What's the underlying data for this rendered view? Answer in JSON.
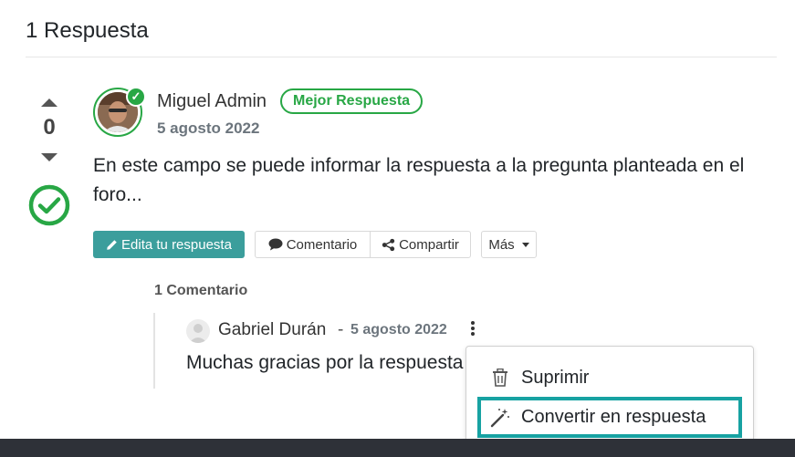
{
  "section": {
    "title": "1 Respuesta"
  },
  "vote": {
    "count": "0"
  },
  "answer": {
    "author": "Miguel Admin",
    "badge": "Mejor Respuesta",
    "date": "5 agosto 2022",
    "text": "En este campo se puede informar la respuesta a la pregunta planteada en el foro..."
  },
  "actions": {
    "edit_label": "Edita tu respuesta",
    "comment_label": "Comentario",
    "share_label": "Compartir",
    "more_label": "Más"
  },
  "comments": {
    "title": "1 Comentario",
    "items": [
      {
        "author": "Gabriel Durán",
        "separator": "-",
        "date": "5 agosto 2022",
        "text": "Muchas gracias por la respuesta"
      }
    ]
  },
  "dropdown": {
    "items": [
      {
        "label": "Suprimir",
        "icon": "trash-icon"
      },
      {
        "label": "Convertir en respuesta",
        "icon": "magic-wand-icon"
      }
    ]
  },
  "colors": {
    "accent": "#3b9e9c",
    "success": "#28a745",
    "highlight": "#17a2a2",
    "footer": "#2e3138"
  }
}
